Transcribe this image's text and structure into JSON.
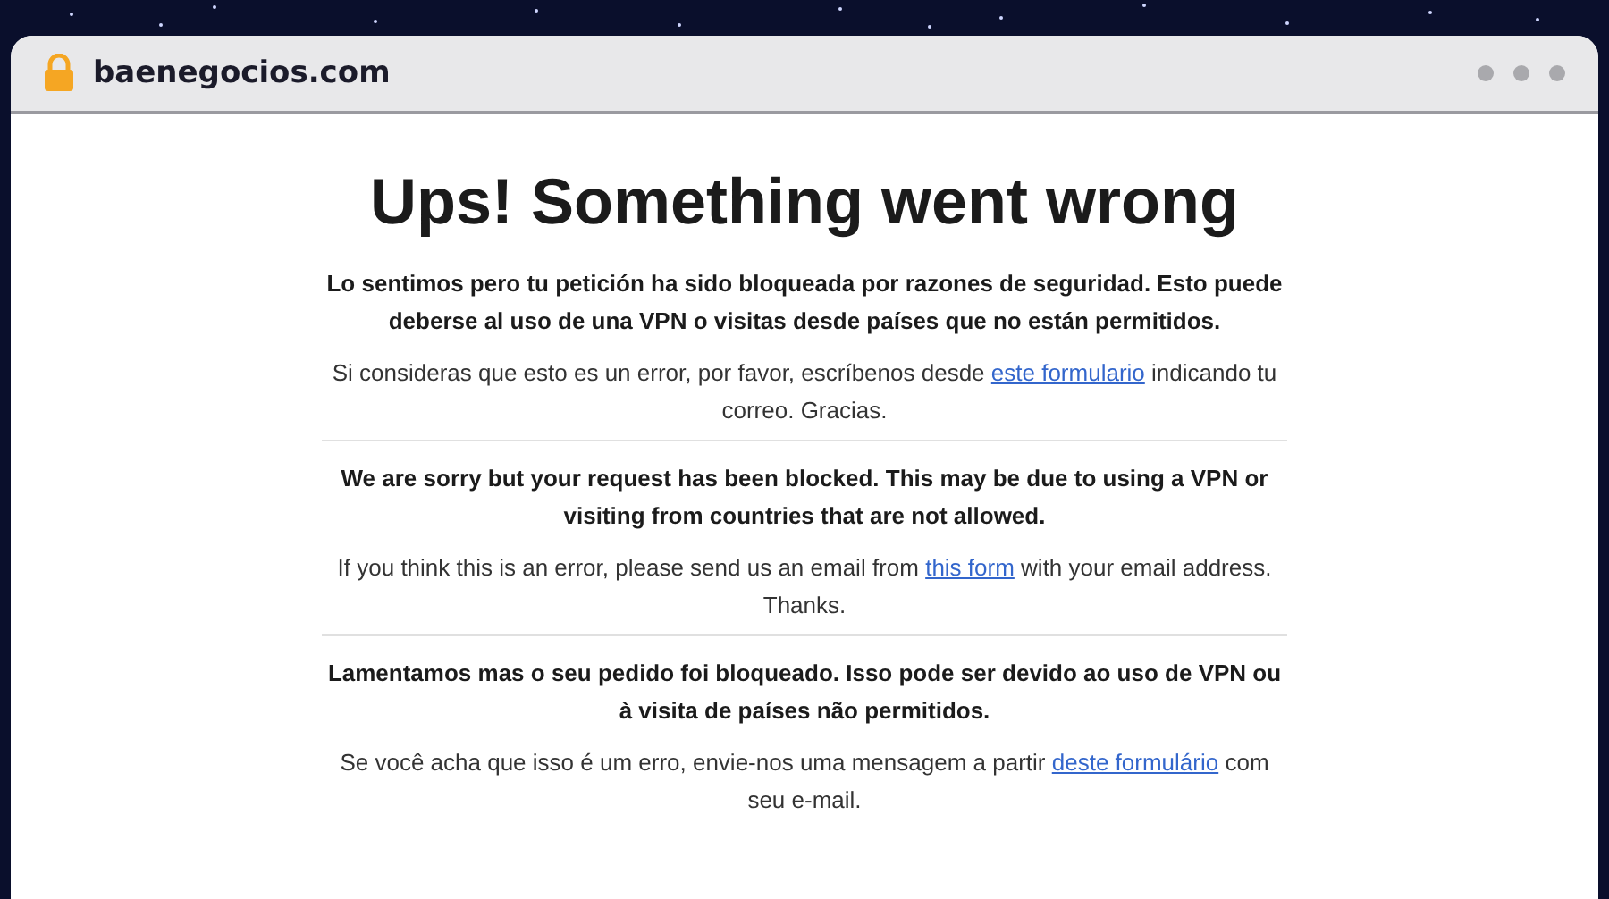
{
  "browser": {
    "address": "baenegocios.com"
  },
  "page": {
    "title": "Ups! Something went wrong",
    "sections": [
      {
        "lead": "Lo sentimos pero tu petición ha sido bloqueada por razones de seguridad. Esto puede deberse al uso de una VPN o visitas desde países que no están permitidos.",
        "body_before": "Si consideras que esto es un error, por favor, escríbenos desde",
        "link": "este formulario",
        "body_after": "indicando tu correo. Gracias."
      },
      {
        "lead": "We are sorry but your request has been blocked. This may be due to using a VPN or visiting from countries that are not allowed.",
        "body_before": "If you think this is an error, please send us an email from",
        "link": "this form",
        "body_after": "with your email address. Thanks."
      },
      {
        "lead": "Lamentamos mas o seu pedido foi bloqueado. Isso pode ser devido ao uso de VPN ou à visita de países não permitidos.",
        "body_before": "Se você acha que isso é um erro, envie-nos uma mensagem a partir",
        "link": "deste formulário",
        "body_after": "com seu e-mail."
      }
    ]
  }
}
